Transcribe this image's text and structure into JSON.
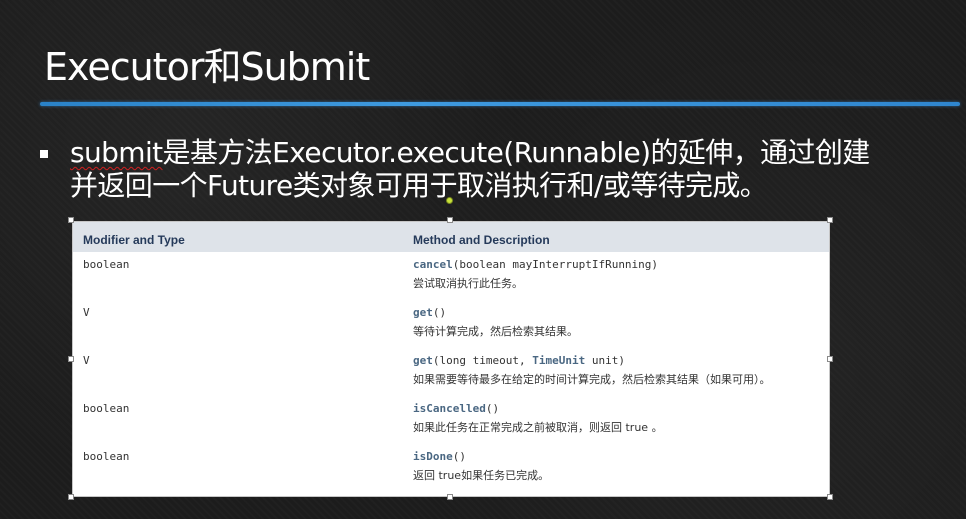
{
  "slide": {
    "title": "Executor和Submit",
    "bullet": {
      "part1_underlined": "submit",
      "part2": "是基方法Executor.execute(Runnable)的延伸，通过创建",
      "line2": "并返回一个Future类对象可用于取消执行和/或等待完成。"
    }
  },
  "colors": {
    "background": "#1c1c1c",
    "accent_line": "#2f86cf",
    "table_header_bg": "#dee3e9",
    "method_name": "#4a6782"
  },
  "table": {
    "headers": {
      "col1": "Modifier and Type",
      "col2": "Method and Description"
    },
    "rows": [
      {
        "type": "boolean",
        "method": "cancel",
        "args": "(boolean mayInterruptIfRunning)",
        "description": "尝试取消执行此任务。"
      },
      {
        "type": "V",
        "method": "get",
        "args": "()",
        "description": "等待计算完成，然后检索其结果。"
      },
      {
        "type": "V",
        "method": "get",
        "args_pre": "(long timeout, ",
        "args_type": "TimeUnit",
        "args_post": " unit)",
        "description": "如果需要等待最多在给定的时间计算完成，然后检索其结果（如果可用）。"
      },
      {
        "type": "boolean",
        "method": "isCancelled",
        "args": "()",
        "description": "如果此任务在正常完成之前被取消，则返回 true 。"
      },
      {
        "type": "boolean",
        "method": "isDone",
        "args": "()",
        "description": "返回 true如果任务已完成。"
      }
    ]
  }
}
